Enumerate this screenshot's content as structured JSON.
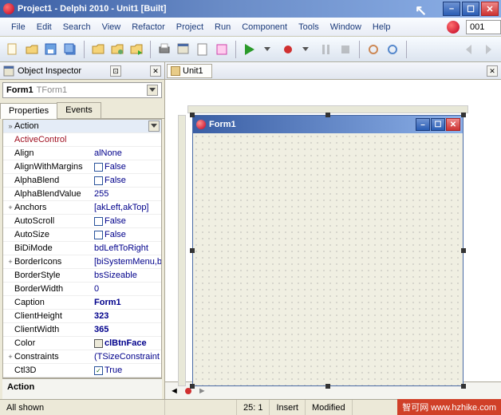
{
  "window": {
    "title": "Project1 - Delphi 2010 - Unit1 [Built]"
  },
  "menu": [
    "File",
    "Edit",
    "Search",
    "View",
    "Refactor",
    "Project",
    "Run",
    "Component",
    "Tools",
    "Window",
    "Help"
  ],
  "menu_input": "001",
  "inspector": {
    "title": "Object Inspector",
    "selected": "Form1",
    "selected_class": "TForm1",
    "tabs": [
      "Properties",
      "Events"
    ],
    "footer": "Action"
  },
  "props": [
    {
      "exp": "»",
      "name": "Action",
      "value": "",
      "sel": true,
      "dd": true
    },
    {
      "name": "ActiveControl",
      "value": "",
      "red": true
    },
    {
      "name": "Align",
      "value": "alNone"
    },
    {
      "name": "AlignWithMargins",
      "chk": true,
      "chkv": false,
      "value": "False"
    },
    {
      "name": "AlphaBlend",
      "chk": true,
      "chkv": false,
      "value": "False"
    },
    {
      "name": "AlphaBlendValue",
      "value": "255"
    },
    {
      "exp": "+",
      "name": "Anchors",
      "value": "[akLeft,akTop]"
    },
    {
      "name": "AutoScroll",
      "chk": true,
      "chkv": false,
      "value": "False"
    },
    {
      "name": "AutoSize",
      "chk": true,
      "chkv": false,
      "value": "False"
    },
    {
      "name": "BiDiMode",
      "value": "bdLeftToRight"
    },
    {
      "exp": "+",
      "name": "BorderIcons",
      "value": "[biSystemMenu,b"
    },
    {
      "name": "BorderStyle",
      "value": "bsSizeable"
    },
    {
      "name": "BorderWidth",
      "value": "0"
    },
    {
      "name": "Caption",
      "value": "Form1",
      "bold": true
    },
    {
      "name": "ClientHeight",
      "value": "323",
      "bold": true
    },
    {
      "name": "ClientWidth",
      "value": "365",
      "bold": true
    },
    {
      "name": "Color",
      "swatch": "#ece9d8",
      "value": "clBtnFace",
      "bold": true
    },
    {
      "exp": "+",
      "name": "Constraints",
      "value": "(TSizeConstraint"
    },
    {
      "name": "Ctl3D",
      "chk": true,
      "chkv": true,
      "value": "True"
    }
  ],
  "designer": {
    "tab": "Unit1",
    "form_title": "Form1"
  },
  "status": {
    "left": "All shown",
    "pos": "25: 1",
    "ins": "Insert",
    "mod": "Modified"
  },
  "watermark": {
    "a": "智可网",
    "b": "www.hzhike.com"
  }
}
